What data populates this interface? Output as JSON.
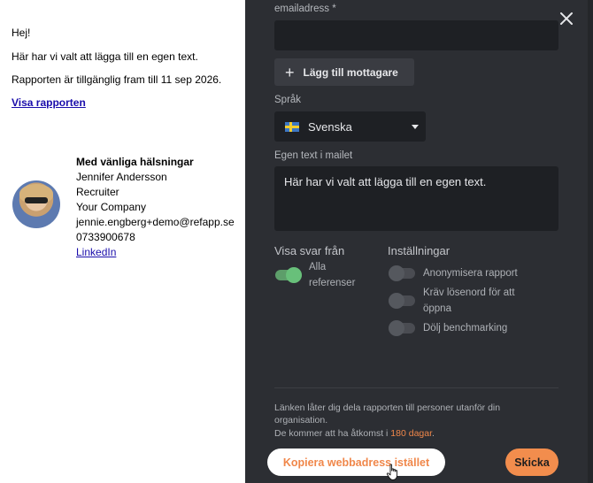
{
  "email": {
    "greeting": "Hej!",
    "custom_text": "Här har vi valt att lägga till en egen text.",
    "availability": "Rapporten är tillgänglig fram till 11 sep 2026.",
    "view_link": "Visa rapporten"
  },
  "signature": {
    "closing": "Med vänliga hälsningar",
    "name": "Jennifer Andersson",
    "title": "Recruiter",
    "company": "Your Company",
    "email": "jennie.engberg+demo@refapp.se",
    "phone": "0733900678",
    "linkedin": "LinkedIn"
  },
  "form": {
    "email_label": "emailadress *",
    "email_value": "",
    "add_recipient": "Lägg till mottagare",
    "language_label": "Språk",
    "language_value": "Svenska",
    "message_label": "Egen text i mailet",
    "message_value": "Här har vi valt att lägga till en egen text."
  },
  "show_answers": {
    "title": "Visa svar från",
    "option_line1": "Alla",
    "option_line2": "referenser",
    "enabled": true
  },
  "settings": {
    "title": "Inställningar",
    "options": [
      {
        "line1": "Anonymisera rapport",
        "line2": "",
        "enabled": false
      },
      {
        "line1": "Kräv lösenord för att",
        "line2": "öppna",
        "enabled": false
      },
      {
        "line1": "Dölj benchmarking",
        "line2": "",
        "enabled": false
      }
    ]
  },
  "info": {
    "line1": "Länken låter dig dela rapporten till personer utanför din",
    "line2": "organisation.",
    "line3_prefix": "De kommer att ha åtkomst i ",
    "line3_highlight": "180 dagar",
    "line3_suffix": "."
  },
  "actions": {
    "copy_link": "Kopiera webbadress istället",
    "send": "Skicka"
  },
  "colors": {
    "panel_bg": "#2c2e33",
    "accent": "#f0874a",
    "toggle_on": "#68c07a"
  }
}
